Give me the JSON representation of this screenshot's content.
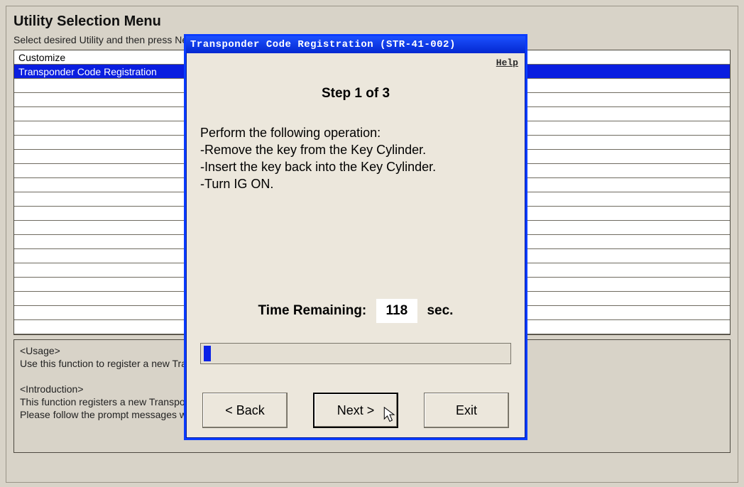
{
  "page": {
    "title": "Utility Selection Menu",
    "subtitle": "Select desired Utility and then press Next"
  },
  "utilityList": {
    "items": [
      "Customize",
      "Transponder Code Registration"
    ],
    "selectedIndex": 1,
    "blankRows": 18
  },
  "usage": {
    "text": "<Usage>\nUse this function to register a new Transp\n\n<Introduction>\nThis function registers a new Transponde\nPlease follow the prompt messages wher"
  },
  "dialog": {
    "title": "Transponder Code Registration (STR-41-002)",
    "help": "Help",
    "stepLabel": "Step 1 of 3",
    "instructions": "Perform the following operation:\n-Remove the key from the Key Cylinder.\n-Insert the key back into the Key Cylinder.\n-Turn IG ON.",
    "timer": {
      "label": "Time Remaining:",
      "value": "118",
      "unit": "sec."
    },
    "progressPercent": 2,
    "buttons": {
      "back": "< Back",
      "next": "Next >",
      "exit": "Exit"
    }
  }
}
